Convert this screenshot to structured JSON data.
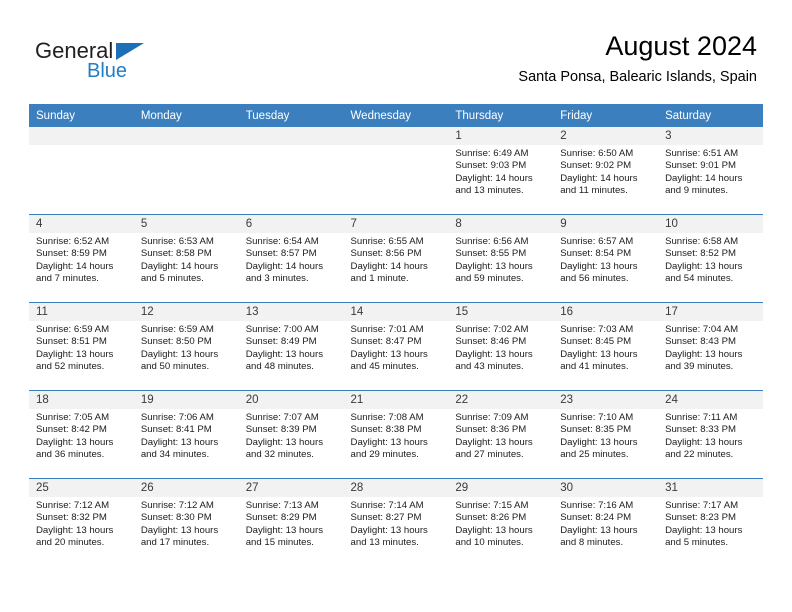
{
  "brand": {
    "name_part1": "General",
    "name_part2": "Blue",
    "accent_color": "#1d6fb8"
  },
  "header": {
    "title": "August 2024",
    "location": "Santa Ponsa, Balearic Islands, Spain"
  },
  "theme": {
    "header_row_bg": "#3b7fbf",
    "daynum_band_bg": "#f2f2f2",
    "cell_bg": "#ffffff",
    "separator": "#3b7fbf"
  },
  "weekday_headers": [
    "Sunday",
    "Monday",
    "Tuesday",
    "Wednesday",
    "Thursday",
    "Friday",
    "Saturday"
  ],
  "weeks": [
    [
      {
        "day": "",
        "lines": []
      },
      {
        "day": "",
        "lines": []
      },
      {
        "day": "",
        "lines": []
      },
      {
        "day": "",
        "lines": []
      },
      {
        "day": "1",
        "lines": [
          "Sunrise: 6:49 AM",
          "Sunset: 9:03 PM",
          "Daylight: 14 hours",
          "and 13 minutes."
        ]
      },
      {
        "day": "2",
        "lines": [
          "Sunrise: 6:50 AM",
          "Sunset: 9:02 PM",
          "Daylight: 14 hours",
          "and 11 minutes."
        ]
      },
      {
        "day": "3",
        "lines": [
          "Sunrise: 6:51 AM",
          "Sunset: 9:01 PM",
          "Daylight: 14 hours",
          "and 9 minutes."
        ]
      }
    ],
    [
      {
        "day": "4",
        "lines": [
          "Sunrise: 6:52 AM",
          "Sunset: 8:59 PM",
          "Daylight: 14 hours",
          "and 7 minutes."
        ]
      },
      {
        "day": "5",
        "lines": [
          "Sunrise: 6:53 AM",
          "Sunset: 8:58 PM",
          "Daylight: 14 hours",
          "and 5 minutes."
        ]
      },
      {
        "day": "6",
        "lines": [
          "Sunrise: 6:54 AM",
          "Sunset: 8:57 PM",
          "Daylight: 14 hours",
          "and 3 minutes."
        ]
      },
      {
        "day": "7",
        "lines": [
          "Sunrise: 6:55 AM",
          "Sunset: 8:56 PM",
          "Daylight: 14 hours",
          "and 1 minute."
        ]
      },
      {
        "day": "8",
        "lines": [
          "Sunrise: 6:56 AM",
          "Sunset: 8:55 PM",
          "Daylight: 13 hours",
          "and 59 minutes."
        ]
      },
      {
        "day": "9",
        "lines": [
          "Sunrise: 6:57 AM",
          "Sunset: 8:54 PM",
          "Daylight: 13 hours",
          "and 56 minutes."
        ]
      },
      {
        "day": "10",
        "lines": [
          "Sunrise: 6:58 AM",
          "Sunset: 8:52 PM",
          "Daylight: 13 hours",
          "and 54 minutes."
        ]
      }
    ],
    [
      {
        "day": "11",
        "lines": [
          "Sunrise: 6:59 AM",
          "Sunset: 8:51 PM",
          "Daylight: 13 hours",
          "and 52 minutes."
        ]
      },
      {
        "day": "12",
        "lines": [
          "Sunrise: 6:59 AM",
          "Sunset: 8:50 PM",
          "Daylight: 13 hours",
          "and 50 minutes."
        ]
      },
      {
        "day": "13",
        "lines": [
          "Sunrise: 7:00 AM",
          "Sunset: 8:49 PM",
          "Daylight: 13 hours",
          "and 48 minutes."
        ]
      },
      {
        "day": "14",
        "lines": [
          "Sunrise: 7:01 AM",
          "Sunset: 8:47 PM",
          "Daylight: 13 hours",
          "and 45 minutes."
        ]
      },
      {
        "day": "15",
        "lines": [
          "Sunrise: 7:02 AM",
          "Sunset: 8:46 PM",
          "Daylight: 13 hours",
          "and 43 minutes."
        ]
      },
      {
        "day": "16",
        "lines": [
          "Sunrise: 7:03 AM",
          "Sunset: 8:45 PM",
          "Daylight: 13 hours",
          "and 41 minutes."
        ]
      },
      {
        "day": "17",
        "lines": [
          "Sunrise: 7:04 AM",
          "Sunset: 8:43 PM",
          "Daylight: 13 hours",
          "and 39 minutes."
        ]
      }
    ],
    [
      {
        "day": "18",
        "lines": [
          "Sunrise: 7:05 AM",
          "Sunset: 8:42 PM",
          "Daylight: 13 hours",
          "and 36 minutes."
        ]
      },
      {
        "day": "19",
        "lines": [
          "Sunrise: 7:06 AM",
          "Sunset: 8:41 PM",
          "Daylight: 13 hours",
          "and 34 minutes."
        ]
      },
      {
        "day": "20",
        "lines": [
          "Sunrise: 7:07 AM",
          "Sunset: 8:39 PM",
          "Daylight: 13 hours",
          "and 32 minutes."
        ]
      },
      {
        "day": "21",
        "lines": [
          "Sunrise: 7:08 AM",
          "Sunset: 8:38 PM",
          "Daylight: 13 hours",
          "and 29 minutes."
        ]
      },
      {
        "day": "22",
        "lines": [
          "Sunrise: 7:09 AM",
          "Sunset: 8:36 PM",
          "Daylight: 13 hours",
          "and 27 minutes."
        ]
      },
      {
        "day": "23",
        "lines": [
          "Sunrise: 7:10 AM",
          "Sunset: 8:35 PM",
          "Daylight: 13 hours",
          "and 25 minutes."
        ]
      },
      {
        "day": "24",
        "lines": [
          "Sunrise: 7:11 AM",
          "Sunset: 8:33 PM",
          "Daylight: 13 hours",
          "and 22 minutes."
        ]
      }
    ],
    [
      {
        "day": "25",
        "lines": [
          "Sunrise: 7:12 AM",
          "Sunset: 8:32 PM",
          "Daylight: 13 hours",
          "and 20 minutes."
        ]
      },
      {
        "day": "26",
        "lines": [
          "Sunrise: 7:12 AM",
          "Sunset: 8:30 PM",
          "Daylight: 13 hours",
          "and 17 minutes."
        ]
      },
      {
        "day": "27",
        "lines": [
          "Sunrise: 7:13 AM",
          "Sunset: 8:29 PM",
          "Daylight: 13 hours",
          "and 15 minutes."
        ]
      },
      {
        "day": "28",
        "lines": [
          "Sunrise: 7:14 AM",
          "Sunset: 8:27 PM",
          "Daylight: 13 hours",
          "and 13 minutes."
        ]
      },
      {
        "day": "29",
        "lines": [
          "Sunrise: 7:15 AM",
          "Sunset: 8:26 PM",
          "Daylight: 13 hours",
          "and 10 minutes."
        ]
      },
      {
        "day": "30",
        "lines": [
          "Sunrise: 7:16 AM",
          "Sunset: 8:24 PM",
          "Daylight: 13 hours",
          "and 8 minutes."
        ]
      },
      {
        "day": "31",
        "lines": [
          "Sunrise: 7:17 AM",
          "Sunset: 8:23 PM",
          "Daylight: 13 hours",
          "and 5 minutes."
        ]
      }
    ]
  ]
}
